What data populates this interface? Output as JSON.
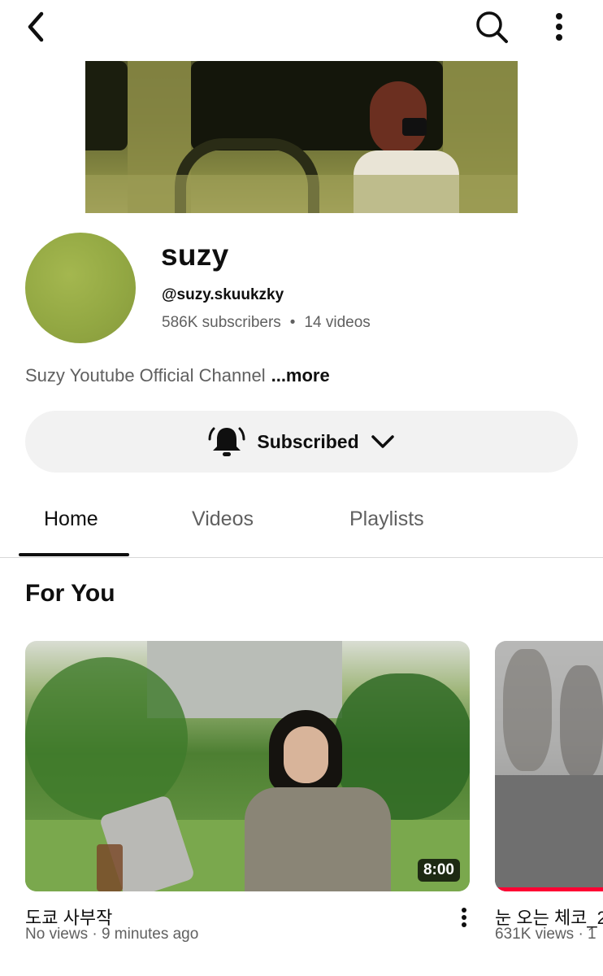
{
  "channel": {
    "name": "suzy",
    "handle": "@suzy.skuukzky",
    "subscribers": "586K subscribers",
    "separator": "•",
    "videos": "14 videos",
    "description": "Suzy Youtube Official Channel",
    "more_label": "...more"
  },
  "subscribe": {
    "label": "Subscribed"
  },
  "tabs": [
    {
      "label": "Home",
      "active": true
    },
    {
      "label": "Videos"
    },
    {
      "label": "Playlists"
    }
  ],
  "section": {
    "title": "For You"
  },
  "videos": [
    {
      "title": "도쿄 사부작",
      "meta": "No views · 9 minutes ago",
      "duration": "8:00"
    },
    {
      "title": "눈 오는 체코_2",
      "meta": "631K views · 1"
    }
  ],
  "icons": {
    "back": "chevron-left-icon",
    "search": "search-icon",
    "more": "more-vertical-icon",
    "bell": "bell-ringing-icon",
    "dropdown": "chevron-down-icon"
  },
  "colors": {
    "progress": "#ff0033",
    "secondary_text": "#606060",
    "subscribe_bg": "#f2f2f2"
  }
}
